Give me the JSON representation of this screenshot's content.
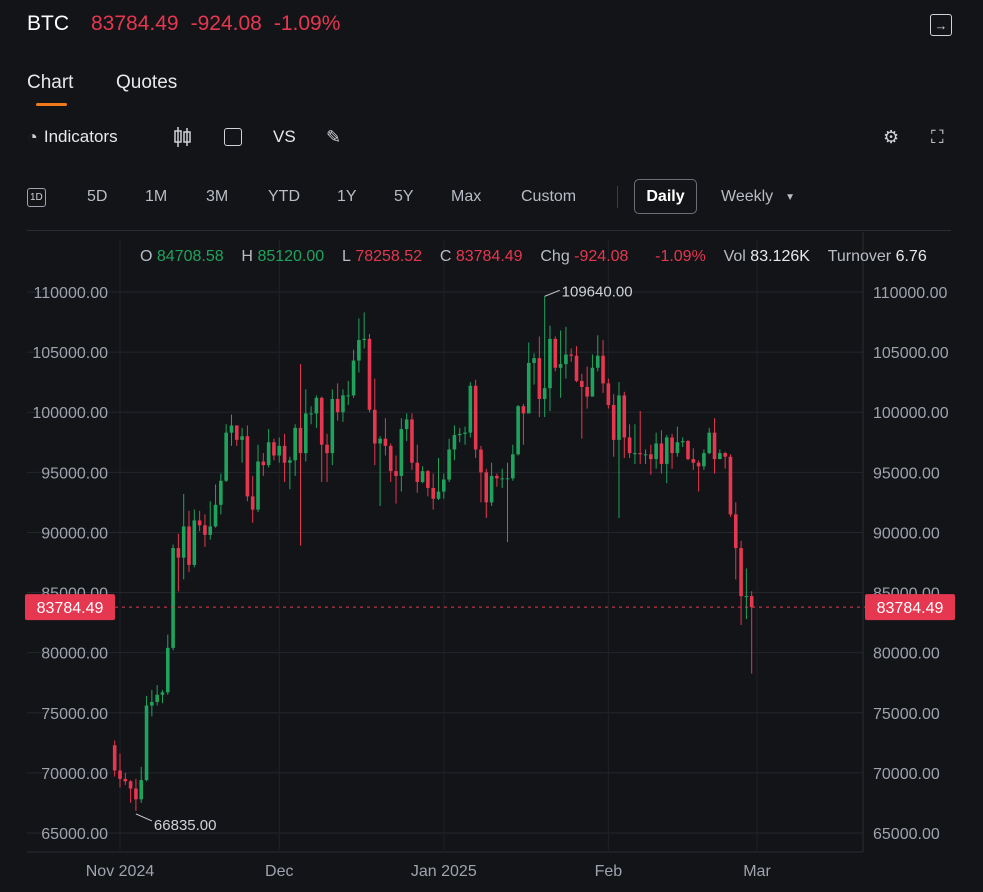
{
  "header": {
    "symbol": "BTC",
    "price": "83784.49",
    "change": "-924.08",
    "change_pct": "-1.09%",
    "exit_icon": "exit-panel-icon"
  },
  "tabs": [
    {
      "label": "Chart",
      "active": true
    },
    {
      "label": "Quotes",
      "active": false
    }
  ],
  "toolbar": {
    "indicators": "Indicators",
    "vs": "VS",
    "icons": [
      "gauge-icon",
      "candlestick-icon",
      "square-icon",
      "pen-icon",
      "gear-icon",
      "expand-icon"
    ]
  },
  "periods": {
    "icon_label": "1D",
    "items": [
      "5D",
      "1M",
      "3M",
      "YTD",
      "1Y",
      "5Y",
      "Max",
      "Custom"
    ],
    "selected": "Daily",
    "dropdown": "Weekly"
  },
  "legend": {
    "o_label": "O",
    "o": "84708.58",
    "h_label": "H",
    "h": "85120.00",
    "l_label": "L",
    "l": "78258.52",
    "c_label": "C",
    "c": "83784.49",
    "chg_label": "Chg",
    "chg": "-924.08",
    "chg_pct": "-1.09%",
    "vol_label": "Vol",
    "vol": "83.126K",
    "turnover_label": "Turnover",
    "turnover": "6.76"
  },
  "colors": {
    "up": "#1fa35c",
    "down": "#e5374f",
    "background": "#131418",
    "accent": "#f07a1a"
  },
  "chart_data": {
    "type": "candlestick",
    "y_ticks": [
      "110000.00",
      "105000.00",
      "100000.00",
      "95000.00",
      "90000.00",
      "85000.00",
      "80000.00",
      "75000.00",
      "70000.00",
      "65000.00"
    ],
    "ylim": [
      65000,
      110000
    ],
    "x_ticks": [
      {
        "label": "Nov 2024",
        "date": "2024-11-01"
      },
      {
        "label": "Dec",
        "date": "2024-12-01"
      },
      {
        "label": "Jan 2025",
        "date": "2025-01-01"
      },
      {
        "label": "Feb",
        "date": "2025-02-01"
      },
      {
        "label": "Mar",
        "date": "2025-03-01"
      }
    ],
    "last_price": "83784.49",
    "max_label": "109640.00",
    "min_label": "66835.00",
    "columns": [
      "date",
      "open",
      "high",
      "low",
      "close"
    ],
    "candles": [
      [
        "2024-10-31",
        72300,
        72700,
        69700,
        70200
      ],
      [
        "2024-11-01",
        70200,
        71600,
        68800,
        69500
      ],
      [
        "2024-11-02",
        69500,
        70000,
        69000,
        69300
      ],
      [
        "2024-11-03",
        69300,
        69400,
        67500,
        68700
      ],
      [
        "2024-11-04",
        68700,
        69500,
        66835,
        67800
      ],
      [
        "2024-11-05",
        67800,
        70500,
        67500,
        69400
      ],
      [
        "2024-11-06",
        69400,
        76400,
        69300,
        75600
      ],
      [
        "2024-11-07",
        75600,
        76900,
        74700,
        75900
      ],
      [
        "2024-11-08",
        75900,
        77300,
        75600,
        76500
      ],
      [
        "2024-11-09",
        76500,
        76900,
        75800,
        76700
      ],
      [
        "2024-11-10",
        76700,
        81500,
        76500,
        80400
      ],
      [
        "2024-11-11",
        80400,
        89000,
        80200,
        88700
      ],
      [
        "2024-11-12",
        88700,
        89900,
        85100,
        87900
      ],
      [
        "2024-11-13",
        87900,
        93200,
        86100,
        90500
      ],
      [
        "2024-11-14",
        90500,
        91800,
        86700,
        87300
      ],
      [
        "2024-11-15",
        87300,
        91900,
        87100,
        91000
      ],
      [
        "2024-11-16",
        91000,
        91800,
        90100,
        90600
      ],
      [
        "2024-11-17",
        90600,
        91500,
        88800,
        89800
      ],
      [
        "2024-11-18",
        89800,
        92600,
        89400,
        90500
      ],
      [
        "2024-11-19",
        90500,
        94000,
        90400,
        92300
      ],
      [
        "2024-11-20",
        92300,
        94900,
        91500,
        94300
      ],
      [
        "2024-11-21",
        94300,
        99000,
        94200,
        98300
      ],
      [
        "2024-11-22",
        98300,
        99800,
        97200,
        98900
      ],
      [
        "2024-11-23",
        98900,
        98900,
        97200,
        97700
      ],
      [
        "2024-11-24",
        97700,
        98700,
        95800,
        98000
      ],
      [
        "2024-11-25",
        98000,
        98900,
        92600,
        93000
      ],
      [
        "2024-11-26",
        93000,
        94700,
        90800,
        91900
      ],
      [
        "2024-11-27",
        91900,
        97300,
        91700,
        95900
      ],
      [
        "2024-11-28",
        95900,
        96600,
        94700,
        95600
      ],
      [
        "2024-11-29",
        95600,
        98600,
        95400,
        97500
      ],
      [
        "2024-11-30",
        97500,
        97800,
        96000,
        96400
      ],
      [
        "2024-12-01",
        96400,
        97900,
        95800,
        97200
      ],
      [
        "2024-12-02",
        97200,
        98200,
        94200,
        95800
      ],
      [
        "2024-12-03",
        95800,
        96300,
        93600,
        96000
      ],
      [
        "2024-12-04",
        96000,
        99000,
        94700,
        98700
      ],
      [
        "2024-12-05",
        98700,
        104000,
        88900,
        96600
      ],
      [
        "2024-12-06",
        96600,
        101900,
        95900,
        99900
      ],
      [
        "2024-12-07",
        99900,
        100500,
        99000,
        99900
      ],
      [
        "2024-12-08",
        99900,
        101400,
        98700,
        101200
      ],
      [
        "2024-12-09",
        101200,
        101300,
        94200,
        97300
      ],
      [
        "2024-12-10",
        97300,
        98200,
        94200,
        96600
      ],
      [
        "2024-12-11",
        96600,
        101900,
        95600,
        101100
      ],
      [
        "2024-12-12",
        101100,
        102400,
        99300,
        100000
      ],
      [
        "2024-12-13",
        100000,
        101900,
        99200,
        101400
      ],
      [
        "2024-12-14",
        101400,
        102600,
        100600,
        101400
      ],
      [
        "2024-12-15",
        101400,
        105200,
        101200,
        104300
      ],
      [
        "2024-12-16",
        104300,
        107800,
        103300,
        106000
      ],
      [
        "2024-12-17",
        106000,
        108300,
        105300,
        106100
      ],
      [
        "2024-12-18",
        106100,
        106500,
        100000,
        100200
      ],
      [
        "2024-12-19",
        100200,
        102800,
        95600,
        97400
      ],
      [
        "2024-12-20",
        97400,
        98000,
        92200,
        97800
      ],
      [
        "2024-12-21",
        97800,
        99500,
        96400,
        97200
      ],
      [
        "2024-12-22",
        97200,
        97400,
        94200,
        95100
      ],
      [
        "2024-12-23",
        95100,
        96400,
        92400,
        94700
      ],
      [
        "2024-12-24",
        94700,
        99500,
        93400,
        98600
      ],
      [
        "2024-12-25",
        98600,
        99900,
        97600,
        99400
      ],
      [
        "2024-12-26",
        99400,
        99900,
        95200,
        95800
      ],
      [
        "2024-12-27",
        95800,
        97300,
        93300,
        94200
      ],
      [
        "2024-12-28",
        94200,
        95500,
        94100,
        95100
      ],
      [
        "2024-12-29",
        95100,
        95200,
        93000,
        93700
      ],
      [
        "2024-12-30",
        93700,
        94900,
        91900,
        92800
      ],
      [
        "2024-12-31",
        92800,
        96200,
        92700,
        93400
      ],
      [
        "2025-01-01",
        93400,
        94900,
        92800,
        94400
      ],
      [
        "2025-01-02",
        94400,
        97800,
        94200,
        96900
      ],
      [
        "2025-01-03",
        96900,
        98900,
        96000,
        98100
      ],
      [
        "2025-01-04",
        98100,
        98700,
        97500,
        98200
      ],
      [
        "2025-01-05",
        98200,
        98800,
        97300,
        98300
      ],
      [
        "2025-01-06",
        98300,
        102500,
        97900,
        102200
      ],
      [
        "2025-01-07",
        102200,
        102700,
        96200,
        96900
      ],
      [
        "2025-01-08",
        96900,
        97200,
        92500,
        95000
      ],
      [
        "2025-01-09",
        95000,
        95300,
        91200,
        92500
      ],
      [
        "2025-01-10",
        92500,
        95800,
        92200,
        94700
      ],
      [
        "2025-01-11",
        94700,
        94900,
        93800,
        94500
      ],
      [
        "2025-01-12",
        94500,
        95300,
        93700,
        94500
      ],
      [
        "2025-01-13",
        94500,
        95800,
        89200,
        94500
      ],
      [
        "2025-01-14",
        94500,
        97300,
        94300,
        96500
      ],
      [
        "2025-01-15",
        96500,
        100600,
        96400,
        100500
      ],
      [
        "2025-01-16",
        100500,
        100700,
        97300,
        99900
      ],
      [
        "2025-01-17",
        99900,
        105800,
        99900,
        104100
      ],
      [
        "2025-01-18",
        104100,
        104900,
        102300,
        104500
      ],
      [
        "2025-01-19",
        104500,
        106300,
        99600,
        101100
      ],
      [
        "2025-01-20",
        101100,
        109640,
        99600,
        102000
      ],
      [
        "2025-01-21",
        102000,
        107200,
        100100,
        106100
      ],
      [
        "2025-01-22",
        106100,
        106300,
        103400,
        103700
      ],
      [
        "2025-01-23",
        103700,
        106800,
        101200,
        104000
      ],
      [
        "2025-01-24",
        104000,
        107100,
        102800,
        104800
      ],
      [
        "2025-01-25",
        104800,
        105300,
        104200,
        104700
      ],
      [
        "2025-01-26",
        104700,
        105500,
        102500,
        102600
      ],
      [
        "2025-01-27",
        102600,
        103200,
        97800,
        102100
      ],
      [
        "2025-01-28",
        102100,
        103800,
        100300,
        101300
      ],
      [
        "2025-01-29",
        101300,
        104800,
        101300,
        103700
      ],
      [
        "2025-01-30",
        103700,
        106400,
        103400,
        104700
      ],
      [
        "2025-01-31",
        104700,
        106000,
        101600,
        102400
      ],
      [
        "2025-02-01",
        102400,
        102800,
        100300,
        100600
      ],
      [
        "2025-02-02",
        100600,
        101500,
        96300,
        97700
      ],
      [
        "2025-02-03",
        97700,
        102500,
        91200,
        101400
      ],
      [
        "2025-02-04",
        101400,
        101700,
        96200,
        97900
      ],
      [
        "2025-02-05",
        97900,
        99000,
        96200,
        96600
      ],
      [
        "2025-02-06",
        96600,
        99000,
        95700,
        96600
      ],
      [
        "2025-02-07",
        96600,
        100100,
        95700,
        96500
      ],
      [
        "2025-02-08",
        96500,
        96900,
        95700,
        96500
      ],
      [
        "2025-02-09",
        96500,
        97300,
        94800,
        96100
      ],
      [
        "2025-02-10",
        96100,
        98300,
        95300,
        97400
      ],
      [
        "2025-02-11",
        97400,
        98500,
        94900,
        95700
      ],
      [
        "2025-02-12",
        95700,
        98100,
        94100,
        97900
      ],
      [
        "2025-02-13",
        97900,
        98200,
        95300,
        96600
      ],
      [
        "2025-02-14",
        96600,
        98800,
        96300,
        97500
      ],
      [
        "2025-02-15",
        97500,
        97900,
        97100,
        97600
      ],
      [
        "2025-02-16",
        97600,
        97700,
        96000,
        96100
      ],
      [
        "2025-02-17",
        96100,
        97000,
        95200,
        95800
      ],
      [
        "2025-02-18",
        95800,
        96000,
        93400,
        95500
      ],
      [
        "2025-02-19",
        95500,
        96900,
        95200,
        96600
      ],
      [
        "2025-02-20",
        96600,
        98700,
        96500,
        98300
      ],
      [
        "2025-02-21",
        98300,
        99500,
        94900,
        96100
      ],
      [
        "2025-02-22",
        96100,
        96900,
        96100,
        96600
      ],
      [
        "2025-02-23",
        96600,
        96700,
        95300,
        96300
      ],
      [
        "2025-02-24",
        96300,
        96500,
        91300,
        91500
      ],
      [
        "2025-02-25",
        91500,
        92500,
        86100,
        88700
      ],
      [
        "2025-02-26",
        88700,
        89300,
        82300,
        84700
      ],
      [
        "2025-02-27",
        84700,
        87000,
        82800,
        84708.58
      ],
      [
        "2025-02-28",
        84708.58,
        85120,
        78258.52,
        83784.49
      ]
    ]
  }
}
